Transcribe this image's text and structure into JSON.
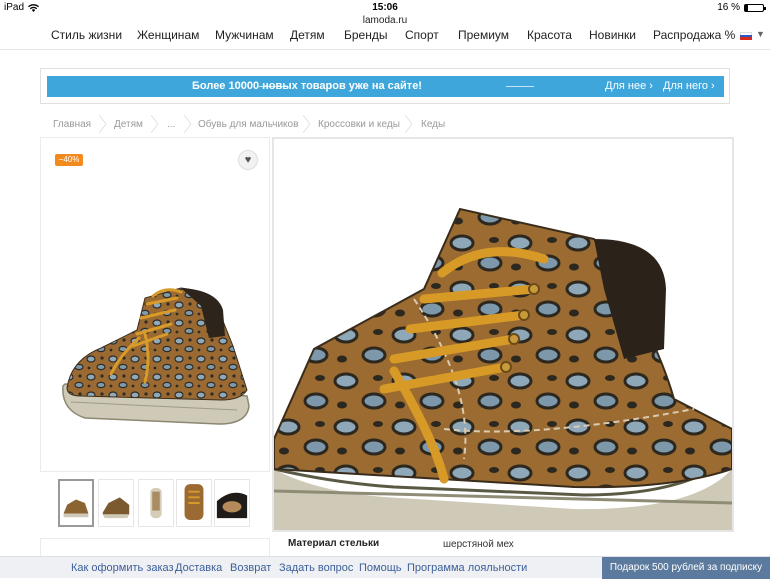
{
  "status_bar": {
    "device": "iPad",
    "time": "15:06",
    "battery": "16 %"
  },
  "browser": {
    "url": "lamoda.ru"
  },
  "nav": {
    "items": [
      "Стиль жизни",
      "Женщинам",
      "Мужчинам",
      "Детям",
      "Бренды",
      "Спорт",
      "Премиум",
      "Красота",
      "Новинки",
      "Распродажа %"
    ],
    "region_flag": "ru-flag-icon"
  },
  "promo": {
    "message": "Более 10000 новых товаров уже на сайте!",
    "link_her": "Для нее",
    "link_him": "Для него",
    "color": "#3fa6dc"
  },
  "breadcrumbs": [
    "Главная",
    "Детям",
    "...",
    "Обувь для мальчиков",
    "Кроссовки и кеды",
    "Кеды"
  ],
  "product": {
    "discount_badge": "−40%",
    "badge_color": "#f38a1d",
    "favorite_icon": "heart-icon",
    "spec_label": "Материал стельки",
    "spec_value": "шерстяной мех"
  },
  "footer": {
    "links": [
      "Как оформить заказ",
      "Доставка",
      "Возврат",
      "Задать вопрос",
      "Помощь",
      "Программа лояльности"
    ],
    "gift_button": "Подарок 500 рублей за подписку",
    "gift_color": "#5b7a9e"
  }
}
